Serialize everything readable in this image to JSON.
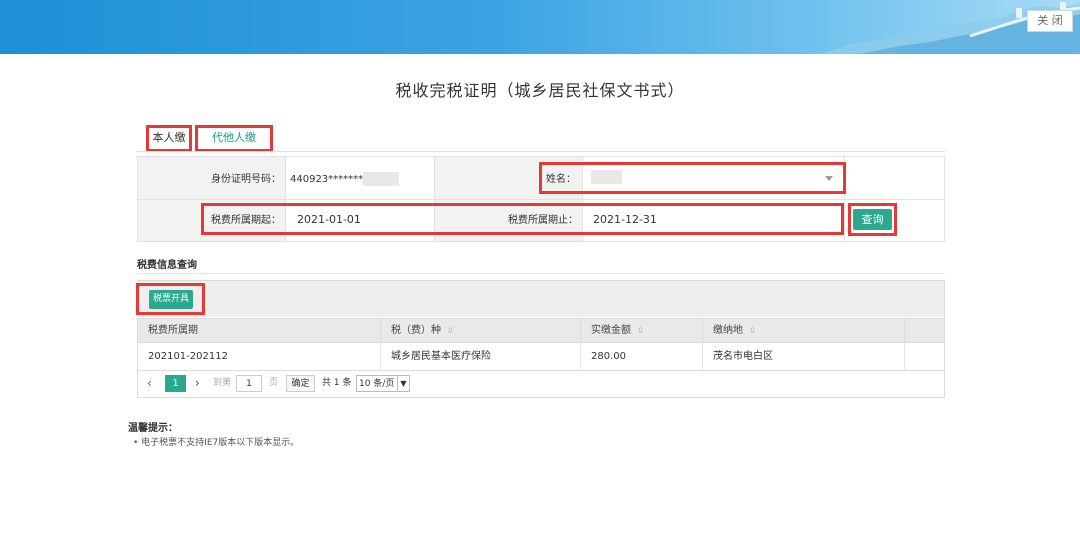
{
  "header": {
    "close_label": "关 闭"
  },
  "page_title": "税收完税证明（城乡居民社保文书式）",
  "tabs": [
    {
      "label": "本人缴"
    },
    {
      "label": "代他人缴"
    }
  ],
  "form": {
    "id_label": "身份证明号码：",
    "id_value": "440923*******",
    "name_label": "姓名：",
    "period_start_label": "税费所属期起：",
    "period_start_value": "2021-01-01",
    "period_end_label": "税费所属期止：",
    "period_end_value": "2021-12-31",
    "query_label": "查询"
  },
  "section": {
    "title": "税费信息查询",
    "issue_label": "税票开具"
  },
  "table": {
    "columns": [
      "税费所属期",
      "税（费）种",
      "实缴金额",
      "缴纳地"
    ],
    "rows": [
      [
        "202101-202112",
        "城乡居民基本医疗保险",
        "280.00",
        "茂名市电白区"
      ]
    ]
  },
  "pager": {
    "prev": "‹",
    "current": "1",
    "next": "›",
    "goto_label": "到第",
    "goto_value": "1",
    "page_unit": "页",
    "confirm": "确定",
    "total": "共 1 条",
    "per_page": "10 条/页"
  },
  "tips": {
    "title": "温馨提示：",
    "items": [
      "电子税票不支持IE7版本以下版本显示。"
    ]
  },
  "colors": {
    "accent": "#2aa98f",
    "highlight": "#e53935",
    "banner": "#2f9be0"
  }
}
